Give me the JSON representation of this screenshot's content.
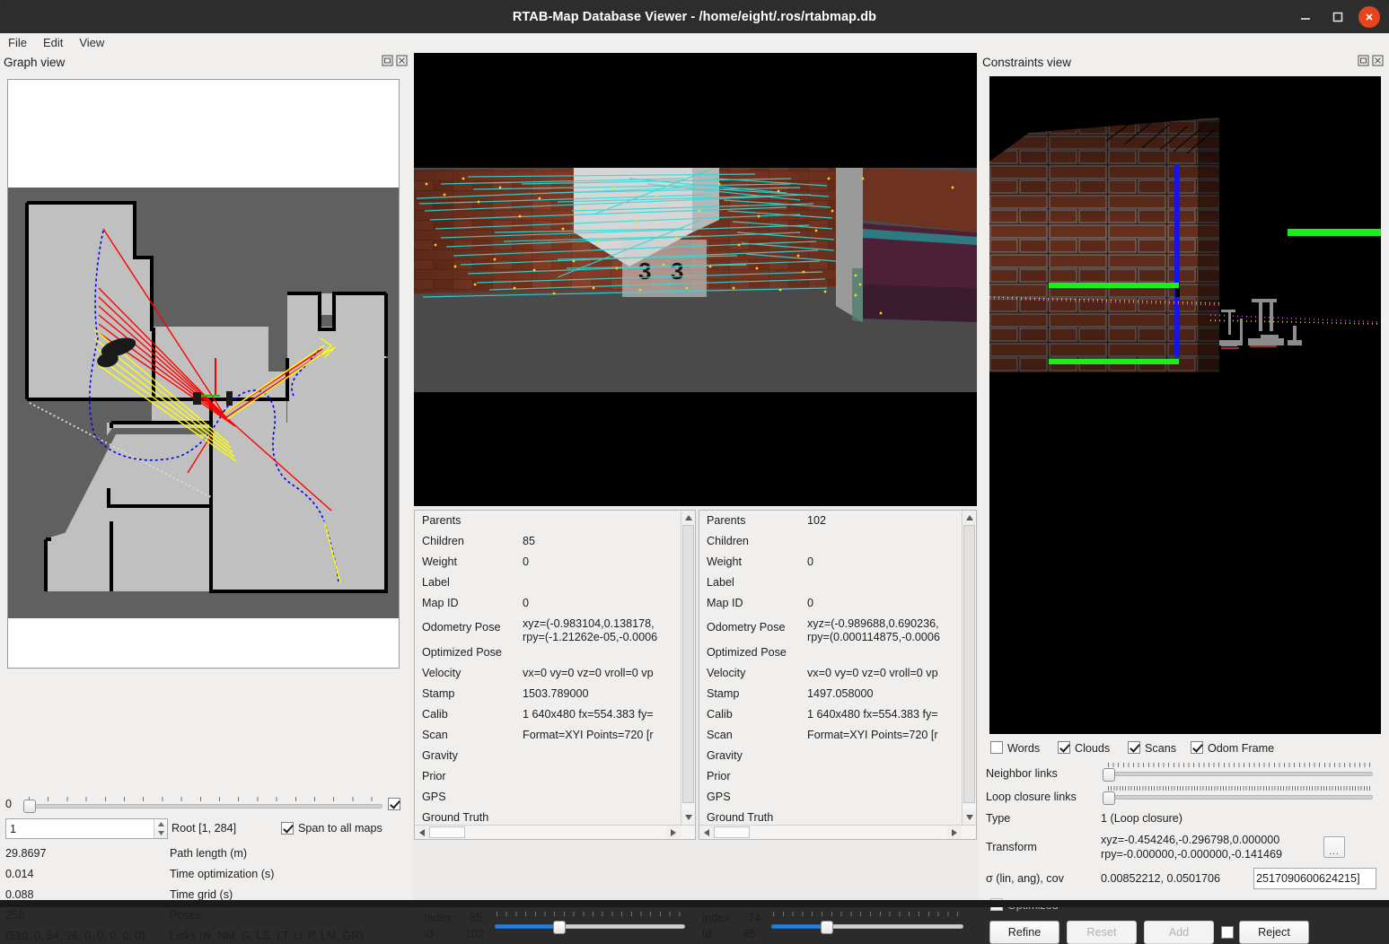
{
  "window": {
    "title": "RTAB-Map Database Viewer - /home/eight/.ros/rtabmap.db",
    "minimize_label": "minimize-window",
    "maximize_label": "maximize-window",
    "close_label": "close-window"
  },
  "menubar": {
    "items": [
      {
        "label": "File"
      },
      {
        "label": "Edit"
      },
      {
        "label": "View"
      }
    ]
  },
  "graph_view": {
    "title": "Graph view",
    "float_icon": "float-dock-icon",
    "close_icon": "close-dock-icon",
    "slider_min_label": "0",
    "slider_checkbox_checked": true,
    "root_spin_value": "1",
    "root_label": "Root [1, 284]",
    "span_label": "Span to all maps",
    "span_checked": true,
    "stats": [
      {
        "value": "29.8697",
        "label": "Path length (m)"
      },
      {
        "value": "0.014",
        "label": "Time optimization (s)"
      },
      {
        "value": "0.088",
        "label": "Time grid (s)"
      },
      {
        "value": "256",
        "label": "Poses"
      },
      {
        "value": "(510, 0, 54, 26, 0, 0, 0, 0, 0)",
        "label": "Links (N, NM, G, LS, LT, U, P, LM, GR)"
      }
    ]
  },
  "center_view": {
    "overlay_text": "3 3",
    "left_table": {
      "rows": [
        {
          "key": "Parents",
          "value": ""
        },
        {
          "key": "Children",
          "value": "85"
        },
        {
          "key": "Weight",
          "value": "0"
        },
        {
          "key": "Label",
          "value": ""
        },
        {
          "key": "Map ID",
          "value": "0"
        },
        {
          "key": "Odometry Pose",
          "value": "xyz=(-0.983104,0.138178,\nrpy=(-1.21262e-05,-0.0006",
          "tall": true
        },
        {
          "key": "Optimized Pose",
          "value": ""
        },
        {
          "key": "Velocity",
          "value": "vx=0 vy=0 vz=0 vroll=0 vp"
        },
        {
          "key": "Stamp",
          "value": "1503.789000"
        },
        {
          "key": "Calib",
          "value": "1 640x480 fx=554.383 fy="
        },
        {
          "key": "Scan",
          "value": "Format=XYI Points=720 [r"
        },
        {
          "key": "Gravity",
          "value": ""
        },
        {
          "key": "Prior",
          "value": ""
        },
        {
          "key": "GPS",
          "value": ""
        },
        {
          "key": "Ground Truth",
          "value": ""
        }
      ],
      "index_label": "Index :",
      "index_value": "85",
      "id_label": "Id :",
      "id_value": "102"
    },
    "right_table": {
      "rows": [
        {
          "key": "Parents",
          "value": "102"
        },
        {
          "key": "Children",
          "value": ""
        },
        {
          "key": "Weight",
          "value": "0"
        },
        {
          "key": "Label",
          "value": ""
        },
        {
          "key": "Map ID",
          "value": "0"
        },
        {
          "key": "Odometry Pose",
          "value": "xyz=(-0.989688,0.690236,\nrpy=(0.000114875,-0.0006",
          "tall": true
        },
        {
          "key": "Optimized Pose",
          "value": ""
        },
        {
          "key": "Velocity",
          "value": "vx=0 vy=0 vz=0 vroll=0 vp"
        },
        {
          "key": "Stamp",
          "value": "1497.058000"
        },
        {
          "key": "Calib",
          "value": "1 640x480 fx=554.383 fy="
        },
        {
          "key": "Scan",
          "value": "Format=XYI Points=720 [r"
        },
        {
          "key": "Gravity",
          "value": ""
        },
        {
          "key": "Prior",
          "value": ""
        },
        {
          "key": "GPS",
          "value": ""
        },
        {
          "key": "Ground Truth",
          "value": ""
        }
      ],
      "index_label": "Index :",
      "index_value": "74",
      "id_label": "Id :",
      "id_value": "85"
    }
  },
  "constraints_view": {
    "title": "Constraints view",
    "float_icon": "float-dock-icon",
    "close_icon": "close-dock-icon",
    "toggles": [
      {
        "label": "Words",
        "checked": false
      },
      {
        "label": "Clouds",
        "checked": true
      },
      {
        "label": "Scans",
        "checked": true
      },
      {
        "label": "Odom Frame",
        "checked": true
      }
    ],
    "neighbor_links_label": "Neighbor links",
    "loop_closure_links_label": "Loop closure links",
    "type_label": "Type",
    "type_value": "1  (Loop closure)",
    "transform_label": "Transform",
    "transform_value": "xyz=-0.454246,-0.296798,0.000000\nrpy=-0.000000,-0.000000,-0.141469",
    "transform_more_button": "...",
    "sigma_label": "σ (lin, ang), cov",
    "sigma_value": "0.00852212, 0.0501706",
    "cov_field_value": "2517090600624215]",
    "optimized_label": "Optimized",
    "optimized_checked": false,
    "buttons": [
      {
        "label": "Refine",
        "enabled": true
      },
      {
        "label": "Reset",
        "enabled": false
      },
      {
        "label": "Add",
        "enabled": false
      },
      {
        "label": "Reject",
        "enabled": true
      }
    ],
    "reject_checkbox_checked": false
  },
  "colors": {
    "accent": "#2a7fd4",
    "close_button": "#e8441c",
    "panel_bg": "#f0efee",
    "titlebar_bg": "#2d2d2d",
    "map_unknown": "#606060",
    "map_free": "#c0c0c0",
    "map_occupied": "#000000",
    "trajectory_blue": "#0000ee",
    "link_red": "#ff0000",
    "link_yellow": "#ffff00",
    "feature_cyan": "#30e0e0",
    "feature_yellow": "#ffd700",
    "axis_green": "#00ff00",
    "axis_blue": "#0000ff"
  }
}
